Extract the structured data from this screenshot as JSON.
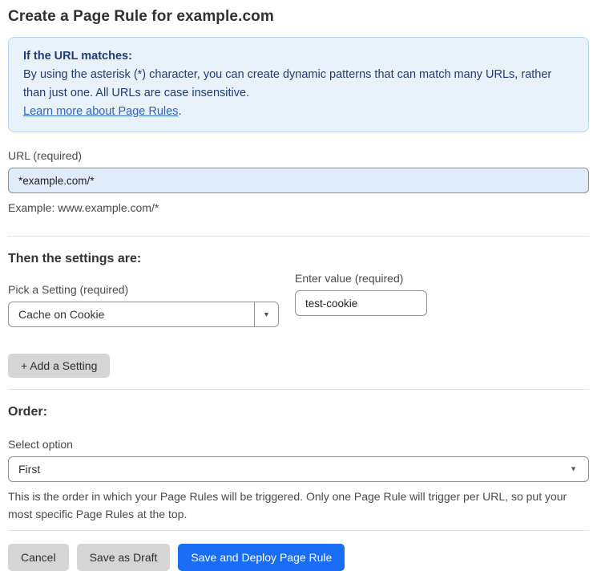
{
  "page": {
    "title": "Create a Page Rule for example.com"
  },
  "info_box": {
    "heading": "If the URL matches:",
    "body": "By using the asterisk (*) character, you can create dynamic patterns that can match many URLs, rather than just one. All URLs are case insensitive.",
    "link_label": "Learn more about Page Rules",
    "link_suffix": "."
  },
  "url_field": {
    "label": "URL (required)",
    "value": "*example.com/*",
    "example": "Example: www.example.com/*"
  },
  "settings_section": {
    "heading": "Then the settings are:",
    "setting_label": "Pick a Setting (required)",
    "setting_value": "Cache on Cookie",
    "value_label": "Enter value (required)",
    "value_value": "test-cookie",
    "add_setting_label": "+ Add a Setting"
  },
  "order_section": {
    "heading": "Order:",
    "select_label": "Select option",
    "select_value": "First",
    "help_text": "This is the order in which your Page Rules will be triggered. Only one Page Rule will trigger per URL, so put your most specific Page Rules at the top."
  },
  "actions": {
    "cancel_label": "Cancel",
    "save_draft_label": "Save as Draft",
    "save_deploy_label": "Save and Deploy Page Rule"
  },
  "icons": {
    "dropdown_arrow": "▼"
  },
  "colors": {
    "info_background": "#e9f2fb",
    "info_border": "#b8d6f3",
    "info_text": "#1e3c78",
    "link_blue": "#2d63cc",
    "url_input_background": "#e0ebfb",
    "primary_button_blue": "#1a6ef5",
    "gray_button": "#d5d5d5",
    "input_border": "#8f8f8f",
    "divider": "#e4e4e4"
  }
}
